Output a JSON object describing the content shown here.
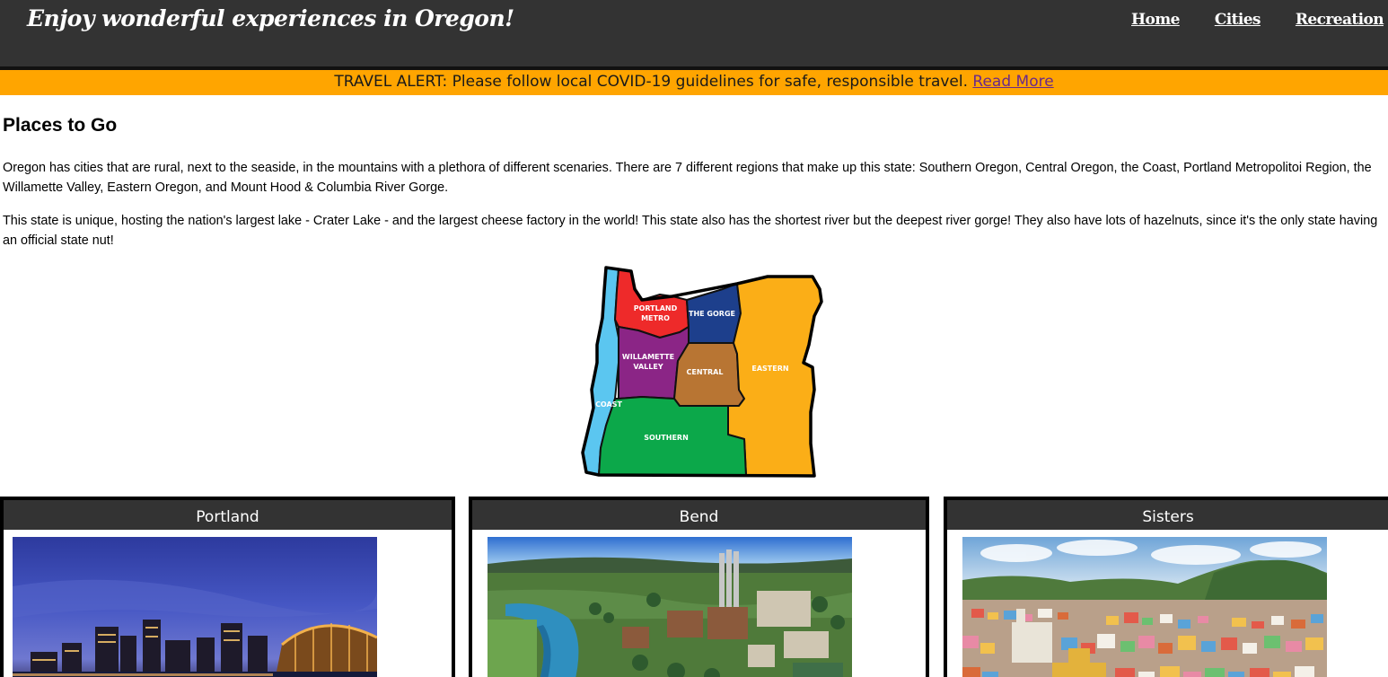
{
  "header": {
    "brand": "Enjoy wonderful experiences in Oregon!",
    "nav": [
      {
        "label": "Home"
      },
      {
        "label": "Cities"
      },
      {
        "label": "Recreation"
      }
    ]
  },
  "alert": {
    "text": "TRAVEL ALERT: Please follow local COVID-19 guidelines for safe, responsible travel.",
    "link": "Read More"
  },
  "main": {
    "title": "Places to Go",
    "paragraphs": [
      "Oregon has cities that are rural, next to the seaside, in the mountains with a plethora of different scenaries. There are 7 different regions that make up this state: Southern Oregon, Central Oregon, the Coast, Portland Metropolitoi Region, the Willamette Valley, Eastern Oregon, and Mount Hood & Columbia River Gorge.",
      "This state is unique, hosting the nation's largest lake - Crater Lake - and the largest cheese factory in the world! This state also has the shortest river but the deepest river gorge! They also have lots of hazelnuts, since it's the only state having an official state nut!"
    ],
    "map": {
      "regions": [
        {
          "label_lines": [
            "PORTLAND",
            "METRO"
          ],
          "color": "#ee2a2a"
        },
        {
          "label_lines": [
            "THE GORGE"
          ],
          "color": "#1d3f8c"
        },
        {
          "label_lines": [
            "WILLAMETTE",
            "VALLEY"
          ],
          "color": "#8b2586"
        },
        {
          "label_lines": [
            "CENTRAL"
          ],
          "color": "#b87533"
        },
        {
          "label_lines": [
            "EASTERN"
          ],
          "color": "#fbae17"
        },
        {
          "label_lines": [
            "COAST"
          ],
          "color": "#5bc6f0"
        },
        {
          "label_lines": [
            "SOUTHERN"
          ],
          "color": "#0ca84a"
        }
      ]
    }
  },
  "cards": [
    {
      "title": "Portland"
    },
    {
      "title": "Bend"
    },
    {
      "title": "Sisters"
    }
  ],
  "colors": {
    "header_bg": "#333333",
    "alert_bg": "#ffa500",
    "link": "#6a2a8a"
  }
}
